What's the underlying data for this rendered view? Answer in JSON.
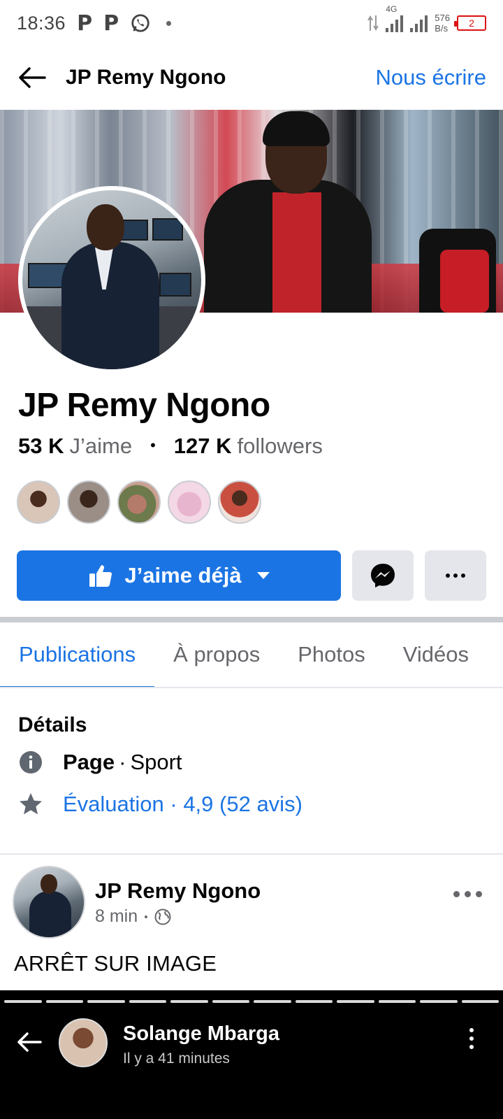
{
  "status_bar": {
    "time": "18:36",
    "network_type": "4G",
    "net_speed_value": "576",
    "net_speed_unit": "B/s",
    "battery_level": "2",
    "icons": [
      "p-icon",
      "p-icon",
      "whatsapp-icon",
      "dot-icon",
      "data-arrows-icon",
      "signal-icon",
      "signal-icon",
      "battery-icon"
    ]
  },
  "header": {
    "title": "JP Remy Ngono",
    "action_label": "Nous écrire"
  },
  "profile": {
    "name": "JP Remy Ngono",
    "likes_count": "53 K",
    "likes_label": "J’aime",
    "separator": "•",
    "followers_count": "127 K",
    "followers_label": "followers",
    "friend_face_colors": [
      "#d9c6b8",
      "#9a8e87",
      "#b47a6a",
      "#e8b5cf",
      "#c95040"
    ]
  },
  "actions": {
    "like_label": "J’aime déjà"
  },
  "tabs": [
    {
      "label": "Publications",
      "active": true
    },
    {
      "label": "À propos",
      "active": false
    },
    {
      "label": "Photos",
      "active": false
    },
    {
      "label": "Vidéos",
      "active": false
    }
  ],
  "details": {
    "title": "Détails",
    "type_label": "Page",
    "dot": "·",
    "category": "Sport",
    "rating_text": "Évaluation · 4,9 (52 avis)"
  },
  "post": {
    "author": "JP Remy Ngono",
    "time": "8 min",
    "text": "ARRÊT SUR IMAGE"
  },
  "story": {
    "author": "Solange Mbarga",
    "time": "Il y a 41 minutes"
  },
  "colors": {
    "accent": "#1b74e4",
    "muted_text": "#65676b",
    "button_gray": "#e4e6eb"
  }
}
